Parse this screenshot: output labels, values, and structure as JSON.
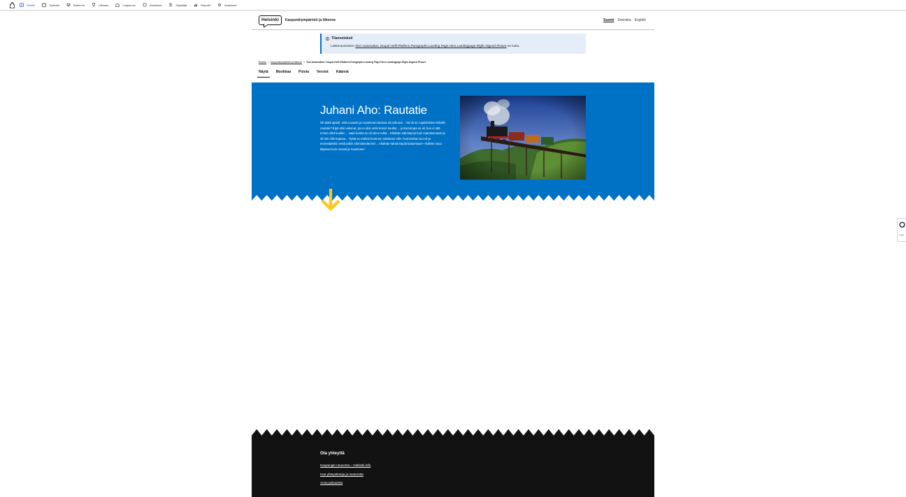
{
  "toolbar": {
    "items": [
      {
        "label": "Sisältö",
        "icon": "content-icon",
        "active": true
      },
      {
        "label": "Työkalut",
        "icon": "tools-icon"
      },
      {
        "label": "Rakenne",
        "icon": "structure-icon"
      },
      {
        "label": "Ulkoasu",
        "icon": "appearance-icon"
      },
      {
        "label": "Laajennus",
        "icon": "extend-icon"
      },
      {
        "label": "Asetukset",
        "icon": "config-icon"
      },
      {
        "label": "Käyttäjät",
        "icon": "people-icon"
      },
      {
        "label": "Raportit",
        "icon": "reports-icon"
      },
      {
        "label": "Asetukset",
        "icon": "settings-icon"
      }
    ]
  },
  "header": {
    "logo": "Helsinki",
    "site_name": "Kaupunkiympäristö ja liikenne",
    "languages": [
      {
        "label": "Suomi",
        "active": true
      },
      {
        "label": "Svenska"
      },
      {
        "label": "English"
      }
    ]
  },
  "status": {
    "title": "Tilanneteksti",
    "text_prefix": "Laskeutumissivu ",
    "text_link": "Test Automation: Drupal-Helfi-Platform.Paragraphs.Landing Page.Hero.Landingpage-Right Aligned Picture",
    "text_suffix": " on luotu."
  },
  "breadcrumb": {
    "items": [
      "Etusivu",
      "Kaupunkiympäristö ja liikenne"
    ],
    "current": "Test Automation: Drupal-Helfi-Platform.Paragraphs.Landing Page.Hero.Landingpage-Right Aligned Picture"
  },
  "tabs": [
    {
      "label": "Näytä",
      "active": true
    },
    {
      "label": "Muokkaa"
    },
    {
      "label": "Poista"
    },
    {
      "label": "Versiot"
    },
    {
      "label": "Käännä"
    }
  ],
  "hero": {
    "title": "Juhani Aho: Rautatie",
    "text": "Oli Matti ajatell, mitä rovastin ja ruustinnan kanssa oli puhunut... Vai oli se Lapinlahden kirkolla rautatie? Eipä olisi uskonut, jos ei olisi omin korvin kuullut ... ja kummapa se oli, kun ei sitä ennen ollut kuullut ... vaan koska se oli sinne tullut... Eikähän sitä käynyt kuin mainitsemaan ja oli heti sille kapusa... Tiyttä se mahtoi kummon näköinen olla—kummahan tuo oli ja ennestäänkin vettä pitkin sitä kätevämmin... eikähän häntä käydä katsomaan—ikähän muut käyneet kuin rovasti ja ruustinna?",
    "image_alt": "steam-train-on-bridge"
  },
  "footer": {
    "title": "Ota yhteyttä",
    "links": [
      "Kaupungin neuvonta – Helsinki-info",
      "Hae yhteystietoja ja numeroita",
      "Anna palautetta"
    ]
  },
  "feedback": {
    "label": "Login"
  }
}
